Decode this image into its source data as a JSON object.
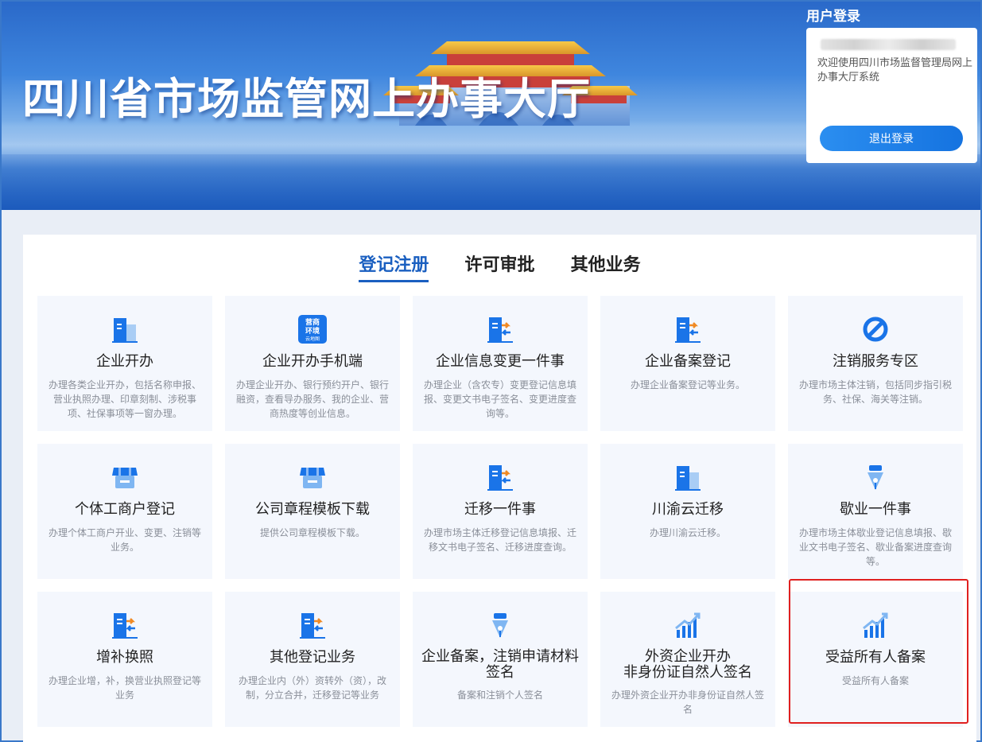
{
  "banner": {
    "title": "四川省市场监管网上办事大厅"
  },
  "login": {
    "title": "用户登录",
    "welcome": "欢迎使用四川市场监督管理局网上办事大厅系统",
    "logout_label": "退出登录"
  },
  "tabs": [
    {
      "label": "登记注册",
      "active": true
    },
    {
      "label": "许可审批",
      "active": false
    },
    {
      "label": "其他业务",
      "active": false
    }
  ],
  "cards": [
    {
      "icon": "building-icon",
      "title": "企业开办",
      "desc": "办理各类企业开办，包括名称申报、营业执照办理、印章刻制、涉税事项、社保事项等一窗办理。"
    },
    {
      "icon": "business-environment-icon",
      "icon_text_1": "营商",
      "icon_text_2": "环境",
      "icon_text_3": "云地图",
      "title": "企业开办手机端",
      "desc": "办理企业开办、银行预约开户、银行融资，查看导办服务、我的企业、营商热度等创业信息。"
    },
    {
      "icon": "transfer-doc-icon",
      "title": "企业信息变更一件事",
      "desc": "办理企业（含农专）变更登记信息填报、变更文书电子签名、变更进度查询等。"
    },
    {
      "icon": "transfer-doc-icon",
      "title": "企业备案登记",
      "desc": "办理企业备案登记等业务。"
    },
    {
      "icon": "prohibit-icon",
      "title": "注销服务专区",
      "desc": "办理市场主体注销，包括同步指引税务、社保、海关等注销。"
    },
    {
      "icon": "storefront-icon",
      "title": "个体工商户登记",
      "desc": "办理个体工商户开业、变更、注销等业务。"
    },
    {
      "icon": "storefront-icon",
      "title": "公司章程模板下载",
      "desc": "提供公司章程模板下载。"
    },
    {
      "icon": "transfer-doc-icon",
      "title": "迁移一件事",
      "desc": "办理市场主体迁移登记信息填报、迁移文书电子签名、迁移进度查询。"
    },
    {
      "icon": "building-icon",
      "title": "川渝云迁移",
      "desc": "办理川渝云迁移。"
    },
    {
      "icon": "pen-nib-icon",
      "title": "歇业一件事",
      "desc": "办理市场主体歇业登记信息填报、歇业文书电子签名、歇业备案进度查询等。"
    },
    {
      "icon": "transfer-doc-icon",
      "title": "增补换照",
      "desc": "办理企业增，补，换营业执照登记等业务"
    },
    {
      "icon": "transfer-doc-icon",
      "title": "其他登记业务",
      "desc": "办理企业内（外）资转外（资），改制，分立合并，迁移登记等业务"
    },
    {
      "icon": "pen-nib-icon",
      "title": "企业备案，注销申请材料签名",
      "desc": "备案和注销个人签名"
    },
    {
      "icon": "growth-chart-icon",
      "title": "外资企业开办\n非身份证自然人签名",
      "desc": "办理外资企业开办非身份证自然人签名"
    },
    {
      "icon": "growth-chart-icon",
      "title": "受益所有人备案",
      "desc": "受益所有人备案"
    }
  ]
}
